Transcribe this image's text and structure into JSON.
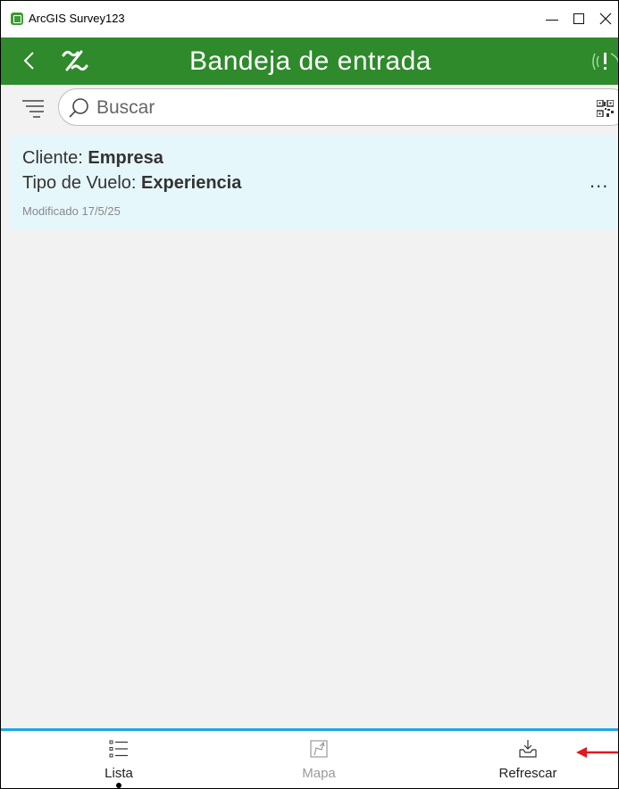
{
  "window": {
    "title": "ArcGIS Survey123",
    "minimize_glyph": "–",
    "maximize_glyph": "☐",
    "close_glyph": "✕"
  },
  "header": {
    "title": "Bandeja de entrada",
    "color": "#2e8a2b",
    "icons": [
      "back-icon",
      "survey123-logo-icon",
      "location-status-icon"
    ]
  },
  "search": {
    "placeholder": "Buscar",
    "value": "",
    "icons": [
      "filter-icon",
      "search-icon",
      "qr-code-icon"
    ]
  },
  "list": {
    "items": [
      {
        "line1_label": "Cliente: ",
        "line1_value": "Empresa",
        "line2_label": "Tipo de Vuelo: ",
        "line2_value": "Experiencia",
        "modified": "Modificado 17/5/25",
        "menu_glyph": "..."
      }
    ],
    "item_bg": "#e6f7fc"
  },
  "bottom_nav": {
    "accent": "#1ea7e1",
    "tabs": [
      {
        "label": "Lista",
        "icon": "list-icon",
        "active": true
      },
      {
        "label": "Mapa",
        "icon": "map-icon",
        "active": false,
        "disabled": true
      },
      {
        "label": "Refrescar",
        "icon": "inbox-download-icon",
        "active": false
      }
    ]
  },
  "annotation": {
    "arrow_color": "#e0191e",
    "icon": "red-arrow-icon"
  }
}
